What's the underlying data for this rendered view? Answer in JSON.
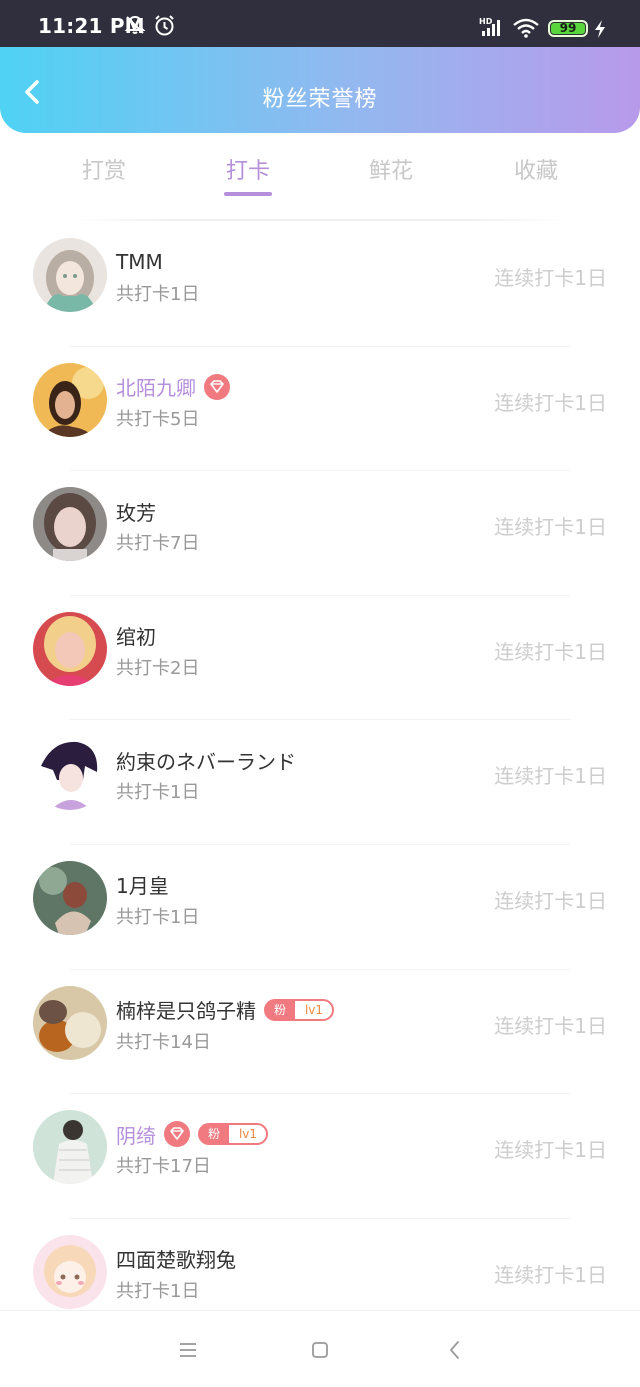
{
  "status_bar": {
    "time": "11:21 PM",
    "battery": "99",
    "icons": [
      "mute-icon",
      "alarm-icon",
      "hd-signal-icon",
      "wifi-icon",
      "battery-icon",
      "charging-icon"
    ]
  },
  "header": {
    "title": "粉丝荣誉榜",
    "back_icon": "back-icon"
  },
  "tabs": [
    {
      "label": "打赏",
      "active": false
    },
    {
      "label": "打卡",
      "active": true
    },
    {
      "label": "鲜花",
      "active": false
    },
    {
      "label": "收藏",
      "active": false
    }
  ],
  "list": [
    {
      "name": "TMM",
      "total": "共打卡1日",
      "streak": "连续打卡1日"
    },
    {
      "name": "北陌九卿",
      "total": "共打卡5日",
      "streak": "连续打卡1日",
      "vip": true
    },
    {
      "name": "玫芳",
      "total": "共打卡7日",
      "streak": "连续打卡1日"
    },
    {
      "name": "绾初",
      "total": "共打卡2日",
      "streak": "连续打卡1日"
    },
    {
      "name": "約束のネバーランド",
      "total": "共打卡1日",
      "streak": "连续打卡1日"
    },
    {
      "name": "1月皇",
      "total": "共打卡1日",
      "streak": "连续打卡1日"
    },
    {
      "name": "楠梓是只鸽子精",
      "total": "共打卡14日",
      "streak": "连续打卡1日",
      "fan_badge": {
        "label": "粉",
        "level": "lv1"
      }
    },
    {
      "name": "阴绮",
      "total": "共打卡17日",
      "streak": "连续打卡1日",
      "vip": true,
      "fan_badge": {
        "label": "粉",
        "level": "lv1"
      }
    },
    {
      "name": "四面楚歌翔兔",
      "total": "共打卡1日",
      "streak": "连续打卡1日"
    }
  ],
  "bottom_nav": {
    "icons": [
      "menu-icon",
      "home-square-icon",
      "back-chevron-icon"
    ]
  },
  "colors": {
    "accent": "#b58fdc",
    "header_gradient_start": "#4fd2f4",
    "header_gradient_end": "#b89aeb",
    "badge": "#f07a80"
  }
}
